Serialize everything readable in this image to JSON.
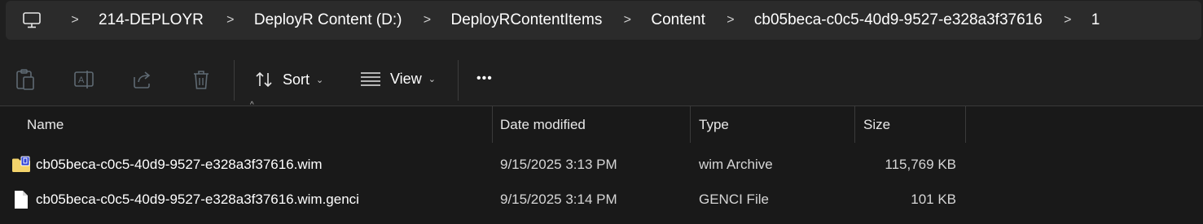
{
  "breadcrumb": {
    "items": [
      "214-DEPLOYR",
      "DeployR Content (D:)",
      "DeployRContentItems",
      "Content",
      "cb05beca-c0c5-40d9-9527-e328a3f37616",
      "1"
    ],
    "separator": ">"
  },
  "toolbar": {
    "sort_label": "Sort",
    "view_label": "View",
    "more_label": "•••",
    "dropdown_chevron": "⌄"
  },
  "columns": {
    "name": "Name",
    "date_modified": "Date modified",
    "type": "Type",
    "size": "Size",
    "sort_indicator": "^"
  },
  "files": [
    {
      "name": "cb05beca-c0c5-40d9-9527-e328a3f37616.wim",
      "date": "9/15/2025 3:13 PM",
      "type": "wim Archive",
      "size": "115,769 KB",
      "icon": "archive-folder-icon"
    },
    {
      "name": "cb05beca-c0c5-40d9-9527-e328a3f37616.wim.genci",
      "date": "9/15/2025 3:14 PM",
      "type": "GENCI File",
      "size": "101 KB",
      "icon": "file-icon"
    }
  ],
  "colors": {
    "background": "#191919",
    "address_bar": "#2b2b2b",
    "accent_folder": "#f3d36b",
    "badge": "#2b3fd6"
  }
}
